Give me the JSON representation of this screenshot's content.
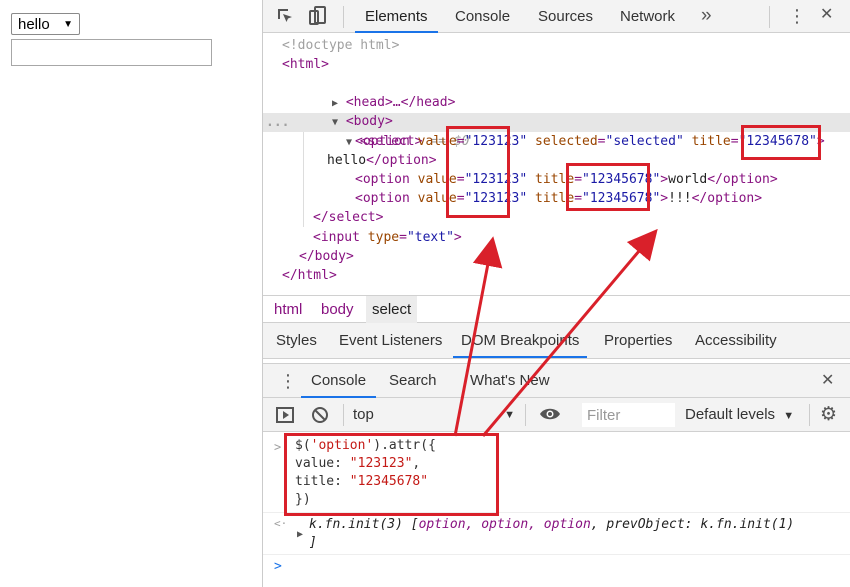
{
  "page": {
    "select_value": "hello",
    "select_arrow": "▼"
  },
  "devtools": {
    "main_tabs": [
      "Elements",
      "Console",
      "Sources",
      "Network"
    ],
    "more_tabs_icon": "»",
    "menu_icon": "⋮",
    "close_icon": "✕",
    "dom": {
      "doctype": "<!doctype html>",
      "html_open": "<html>",
      "head": "<head>…</head>",
      "body_open": "<body>",
      "select_open": "<select>",
      "select_ref": "== $0",
      "opt1_value": "\"123123\"",
      "opt1_selected_attr": "selected",
      "opt1_selected_val": "\"selected\"",
      "opt1_title": "\"12345678\"",
      "opt1_text": "hello",
      "opt2_value": "\"123123\"",
      "opt2_title": "\"12345678\"",
      "opt2_text": "world",
      "opt3_value": "\"123123\"",
      "opt3_title": "\"12345678\"",
      "opt3_text": "!!!",
      "select_close": "</select>",
      "input_type": "\"text\"",
      "body_close": "</body>",
      "html_close": "</html>",
      "ellipsis": "..."
    },
    "breadcrumb": [
      "html",
      "body",
      "select"
    ],
    "styles_tabs": [
      "Styles",
      "Event Listeners",
      "DOM Breakpoints",
      "Properties",
      "Accessibility"
    ],
    "drawer_tabs": [
      "Console",
      "Search",
      "What's New"
    ],
    "console_toolbar": {
      "context": "top",
      "context_arrow": "▼",
      "filter_placeholder": "Filter",
      "levels": "Default levels",
      "levels_arrow": "▼"
    },
    "console": {
      "input_prompt": ">",
      "cmd_line1_a": "$(",
      "cmd_line1_str": "'option'",
      "cmd_line1_b": ").attr({",
      "cmd_line2_key": "value: ",
      "cmd_line2_val": "\"123123\"",
      "cmd_line2_end": ",",
      "cmd_line3_key": "title: ",
      "cmd_line3_val": "\"12345678\"",
      "cmd_line4": "})",
      "result_prompt": "<·",
      "result_line1_a": "k.fn.init(3) [",
      "result_line1_obj": "option, option, option",
      "result_line1_b": ", prevObject: k.fn.init(1)",
      "result_line2": "]",
      "new_prompt": ">"
    },
    "colors": {
      "accent": "#1a73e8",
      "annotation_red": "#d9202a",
      "tag_purple": "#881280",
      "attr_value_blue": "#1a1aa6",
      "string_red": "#c41a16"
    }
  }
}
